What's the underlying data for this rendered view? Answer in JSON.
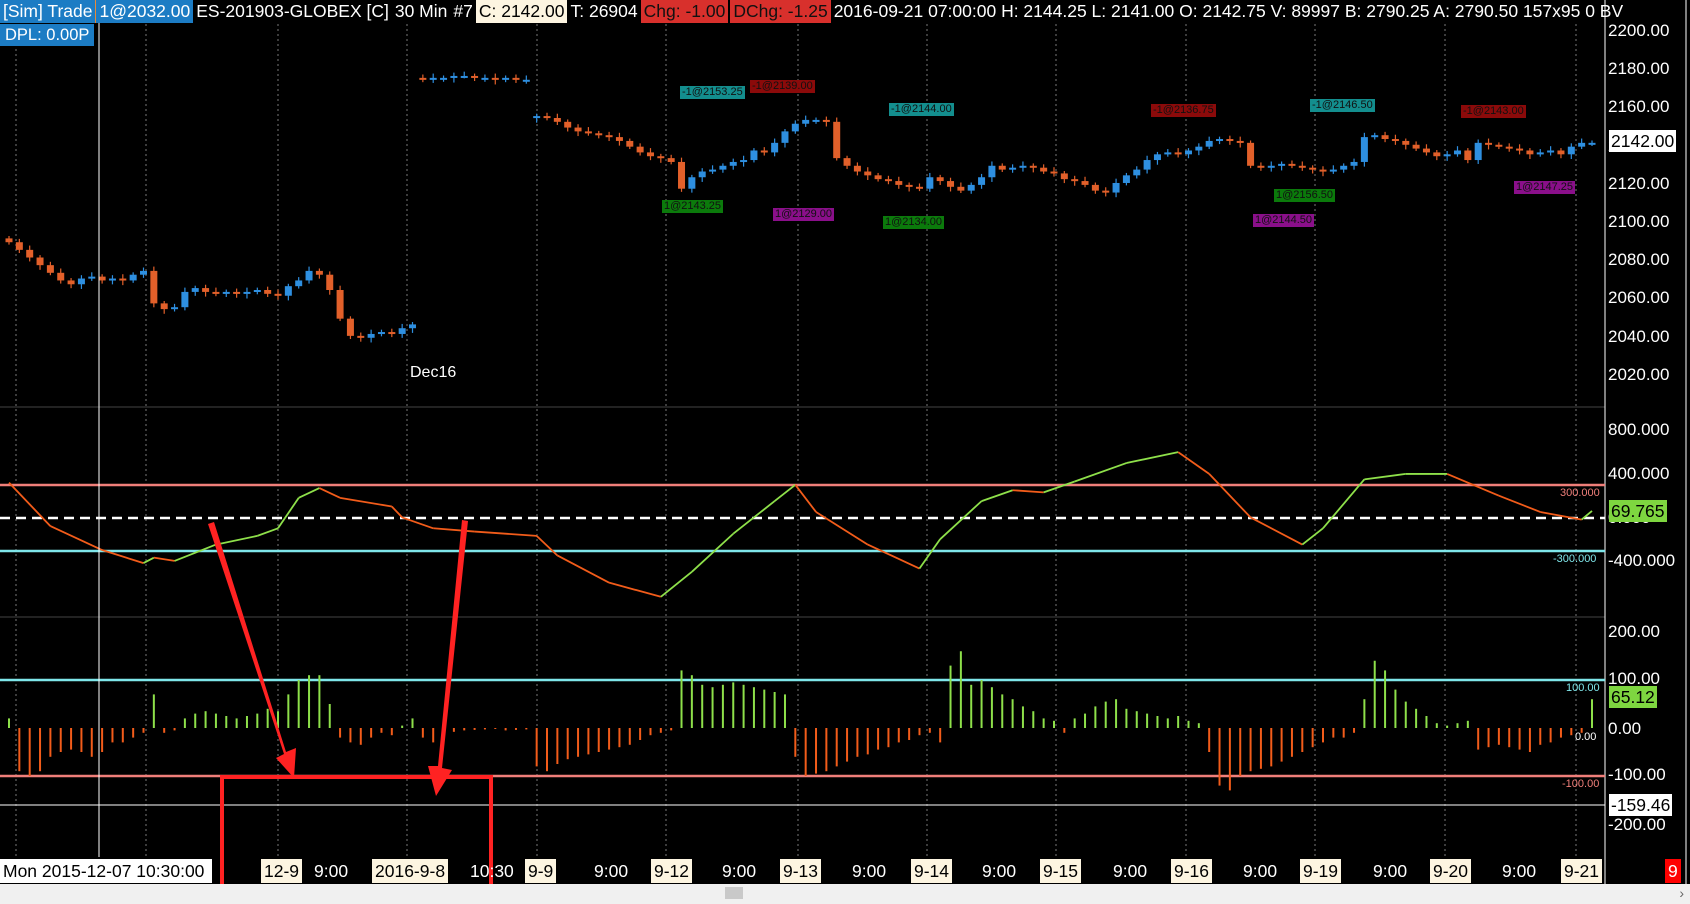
{
  "header": {
    "sim_trade": "[Sim]  Trade",
    "last_trade": "1@2032.00",
    "symbol": "ES-201903-GLOBEX [C]",
    "interval": "30 Min",
    "bar_num": "#7",
    "close": "C: 2142.00",
    "ticks": "T: 26904",
    "chg": "Chg: -1.00",
    "dchg": "DChg: -1.25",
    "details": "2016-09-21 07:00:00 H: 2144.25 L: 2141.00 O: 2142.75 V: 89997 B: 2790.25 A: 2790.50 157x95 0 BV",
    "dpl": "DPL: 0.00P"
  },
  "colors": {
    "up": "#2e8fe0",
    "down": "#e2602a",
    "osc_up": "#8ee04a",
    "osc_down": "#f25c1a",
    "upper_band": "#f07f7a",
    "lower_band": "#7fe6ea"
  },
  "price_axis": {
    "ticks": [
      "2200.00",
      "2180.00",
      "2160.00",
      "2140.00",
      "2120.00",
      "2100.00",
      "2080.00",
      "2060.00",
      "2040.00",
      "2020.00"
    ],
    "current": "2142.00",
    "contract_label": "Dec16"
  },
  "osc_axis": {
    "ticks": [
      "800.000",
      "400.000",
      "0.000",
      "-400.000"
    ],
    "current": "69.765",
    "upper_label": "300.000",
    "lower_label": "-300.000",
    "upper": 300,
    "lower": -300
  },
  "hist_axis": {
    "ticks": [
      "200.00",
      "100.00",
      "0.00",
      "-100.00",
      "-200.00"
    ],
    "current": "65.12",
    "crosshair": "-159.46",
    "upper_label": "100.00",
    "zero_label": "0.00",
    "lower_label": "-100.00"
  },
  "x_axis": {
    "cursor": "Mon 2015-12-07  10:30:00",
    "labels": [
      "12-9",
      "9:00",
      "2016-9-8",
      "10:30",
      "9-9",
      "9:00",
      "9-12",
      "9:00",
      "9-13",
      "9:00",
      "9-14",
      "9:00",
      "9-15",
      "9:00",
      "9-16",
      "9:00",
      "9-19",
      "9:00",
      "9-20",
      "9:00",
      "9-21"
    ],
    "corner": "9"
  },
  "trades": [
    "-1@2153.25",
    "-1@2139.00",
    "1@2143.25",
    "1@2129.00",
    "-1@2144.00",
    "1@2134.00",
    "-1@2136.75",
    "-1@2146.50",
    "1@2156.50",
    "1@2144.50",
    "-1@2143.00",
    "1@2147.25"
  ],
  "chart_data": {
    "type": "candlestick",
    "closes": [
      2090,
      2086,
      2082,
      2078,
      2074,
      2070,
      2068,
      2071,
      2072,
      2070,
      2071,
      2070,
      2073,
      2075,
      2058,
      2055,
      2056,
      2064,
      2066,
      2064,
      2063,
      2064,
      2063,
      2064,
      2065,
      2063,
      2062,
      2067,
      2070,
      2075,
      2073,
      2065,
      2050,
      2041,
      2040,
      2042,
      2043,
      2042,
      2045,
      2047,
      2175,
      2176,
      2176,
      2177,
      2177,
      2176,
      2176,
      2175,
      2176,
      2175,
      2175,
      2156,
      2155,
      2153,
      2150,
      2148,
      2147,
      2146,
      2145,
      2143,
      2140,
      2137,
      2135,
      2134,
      2132,
      2118,
      2124,
      2127,
      2128,
      2130,
      2132,
      2133,
      2138,
      2137,
      2142,
      2148,
      2152,
      2154,
      2154,
      2153,
      2134,
      2130,
      2127,
      2125,
      2123,
      2122,
      2120,
      2119,
      2118,
      2124,
      2122,
      2119,
      2117,
      2120,
      2124,
      2130,
      2128,
      2129,
      2130,
      2129,
      2127,
      2126,
      2123,
      2122,
      2120,
      2117,
      2116,
      2121,
      2125,
      2128,
      2133,
      2136,
      2137,
      2136,
      2138,
      2140,
      2143,
      2144,
      2143,
      2142,
      2130,
      2129,
      2130,
      2131,
      2130,
      2129,
      2128,
      2127,
      2128,
      2130,
      2132,
      2145,
      2146,
      2144,
      2143,
      2141,
      2139,
      2137,
      2135,
      2136,
      2138,
      2133,
      2142,
      2141,
      2140,
      2139,
      2138,
      2136,
      2137,
      2138,
      2136,
      2140,
      2142,
      2142
    ],
    "oscillator": [
      [
        0,
        330
      ],
      [
        4,
        -70
      ],
      [
        9,
        -290
      ],
      [
        13,
        -410
      ],
      [
        14,
        -360
      ],
      [
        16,
        -390
      ],
      [
        20,
        -240
      ],
      [
        24,
        -160
      ],
      [
        26,
        -90
      ],
      [
        28,
        190
      ],
      [
        30,
        280
      ],
      [
        32,
        190
      ],
      [
        37,
        110
      ],
      [
        38,
        10
      ],
      [
        41,
        -90
      ],
      [
        45,
        -120
      ],
      [
        51,
        -160
      ],
      [
        53,
        -340
      ],
      [
        58,
        -590
      ],
      [
        63,
        -720
      ],
      [
        66,
        -490
      ],
      [
        70,
        -140
      ],
      [
        74,
        160
      ],
      [
        76,
        310
      ],
      [
        78,
        60
      ],
      [
        83,
        -240
      ],
      [
        88,
        -460
      ],
      [
        90,
        -190
      ],
      [
        94,
        160
      ],
      [
        97,
        260
      ],
      [
        100,
        240
      ],
      [
        103,
        340
      ],
      [
        108,
        510
      ],
      [
        113,
        610
      ],
      [
        116,
        410
      ],
      [
        120,
        10
      ],
      [
        125,
        -240
      ],
      [
        127,
        -90
      ],
      [
        131,
        360
      ],
      [
        135,
        410
      ],
      [
        139,
        410
      ],
      [
        144,
        210
      ],
      [
        148,
        60
      ],
      [
        152,
        -10
      ],
      [
        153,
        70
      ]
    ],
    "histogram": [
      20,
      -90,
      -100,
      -90,
      -60,
      -50,
      -45,
      -50,
      -60,
      -50,
      -30,
      -30,
      -20,
      -10,
      70,
      -10,
      -5,
      20,
      30,
      35,
      30,
      25,
      20,
      25,
      30,
      40,
      35,
      70,
      100,
      110,
      110,
      50,
      -20,
      -30,
      -35,
      -20,
      -10,
      -15,
      5,
      20,
      -20,
      -30,
      -10,
      -8,
      -5,
      -4,
      -3,
      -2,
      -5,
      -4,
      -3,
      -80,
      -90,
      -75,
      -65,
      -60,
      -55,
      -50,
      -45,
      -40,
      -35,
      -25,
      -15,
      -10,
      -5,
      120,
      110,
      90,
      85,
      90,
      95,
      90,
      85,
      80,
      75,
      70,
      -60,
      -100,
      -95,
      -90,
      -80,
      -70,
      -60,
      -55,
      -45,
      -40,
      -30,
      -25,
      -15,
      -10,
      -30,
      130,
      160,
      90,
      100,
      85,
      70,
      60,
      45,
      35,
      20,
      15,
      -10,
      20,
      30,
      45,
      55,
      60,
      40,
      35,
      30,
      25,
      20,
      25,
      15,
      10,
      -50,
      -120,
      -130,
      -100,
      -90,
      -85,
      -80,
      -70,
      -60,
      -50,
      -40,
      -30,
      -20,
      -20,
      -10,
      60,
      140,
      120,
      80,
      55,
      40,
      25,
      10,
      5,
      10,
      15,
      -45,
      -40,
      -35,
      -40,
      -45,
      -50,
      -35,
      -30,
      -20,
      -15,
      -10,
      60
    ]
  }
}
